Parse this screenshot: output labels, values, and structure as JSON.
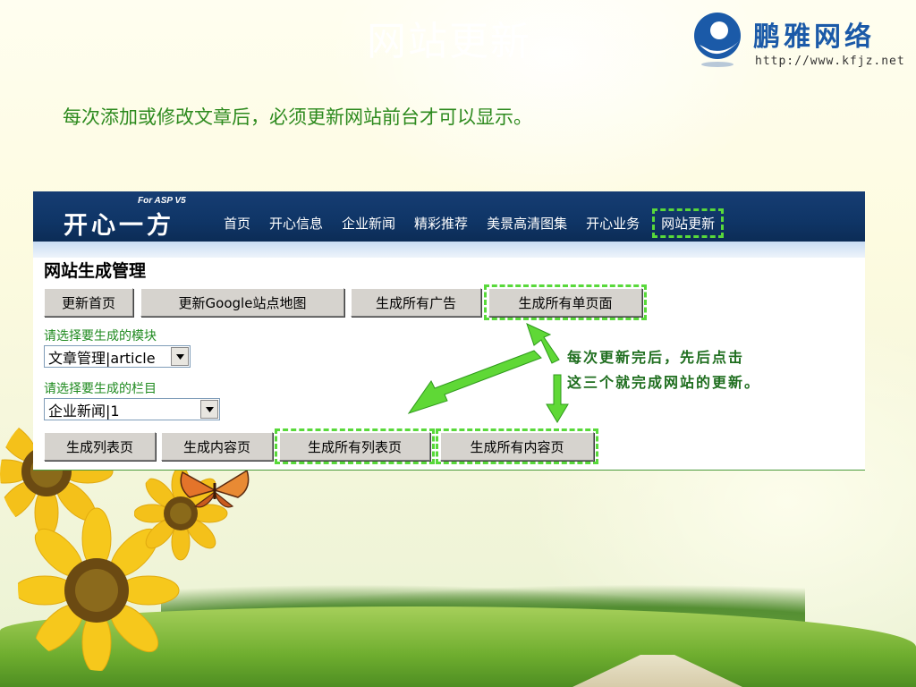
{
  "slide": {
    "title": "网站更新",
    "intro": "每次添加或修改文章后，必须更新网站前台才可以显示。"
  },
  "logo": {
    "name": "鹏雅网络",
    "url": "http://www.kfjz.net"
  },
  "app": {
    "brand": "开心一方",
    "brand_sub": "For ASP V5",
    "nav": [
      "首页",
      "开心信息",
      "企业新闻",
      "精彩推荐",
      "美景高清图集",
      "开心业务",
      "网站更新"
    ],
    "section_title": "网站生成管理",
    "top_buttons": {
      "update_home": "更新首页",
      "update_sitemap": "更新Google站点地图",
      "gen_all_ads": "生成所有广告",
      "gen_all_single": "生成所有单页面"
    },
    "module_label": "请选择要生成的模块",
    "module_value": "文章管理|article",
    "column_label": "请选择要生成的栏目",
    "column_value": "企业新闻|1",
    "bottom_buttons": {
      "gen_list": "生成列表页",
      "gen_content": "生成内容页",
      "gen_all_list": "生成所有列表页",
      "gen_all_content": "生成所有内容页"
    },
    "note_line1": "每次更新完后，先后点击",
    "note_line2": "这三个就完成网站的更新。"
  },
  "colors": {
    "nav_bg": "#0f3566",
    "highlight": "#58d93a",
    "intro_text": "#2d8a1e",
    "logo_blue": "#1b5aa8"
  }
}
